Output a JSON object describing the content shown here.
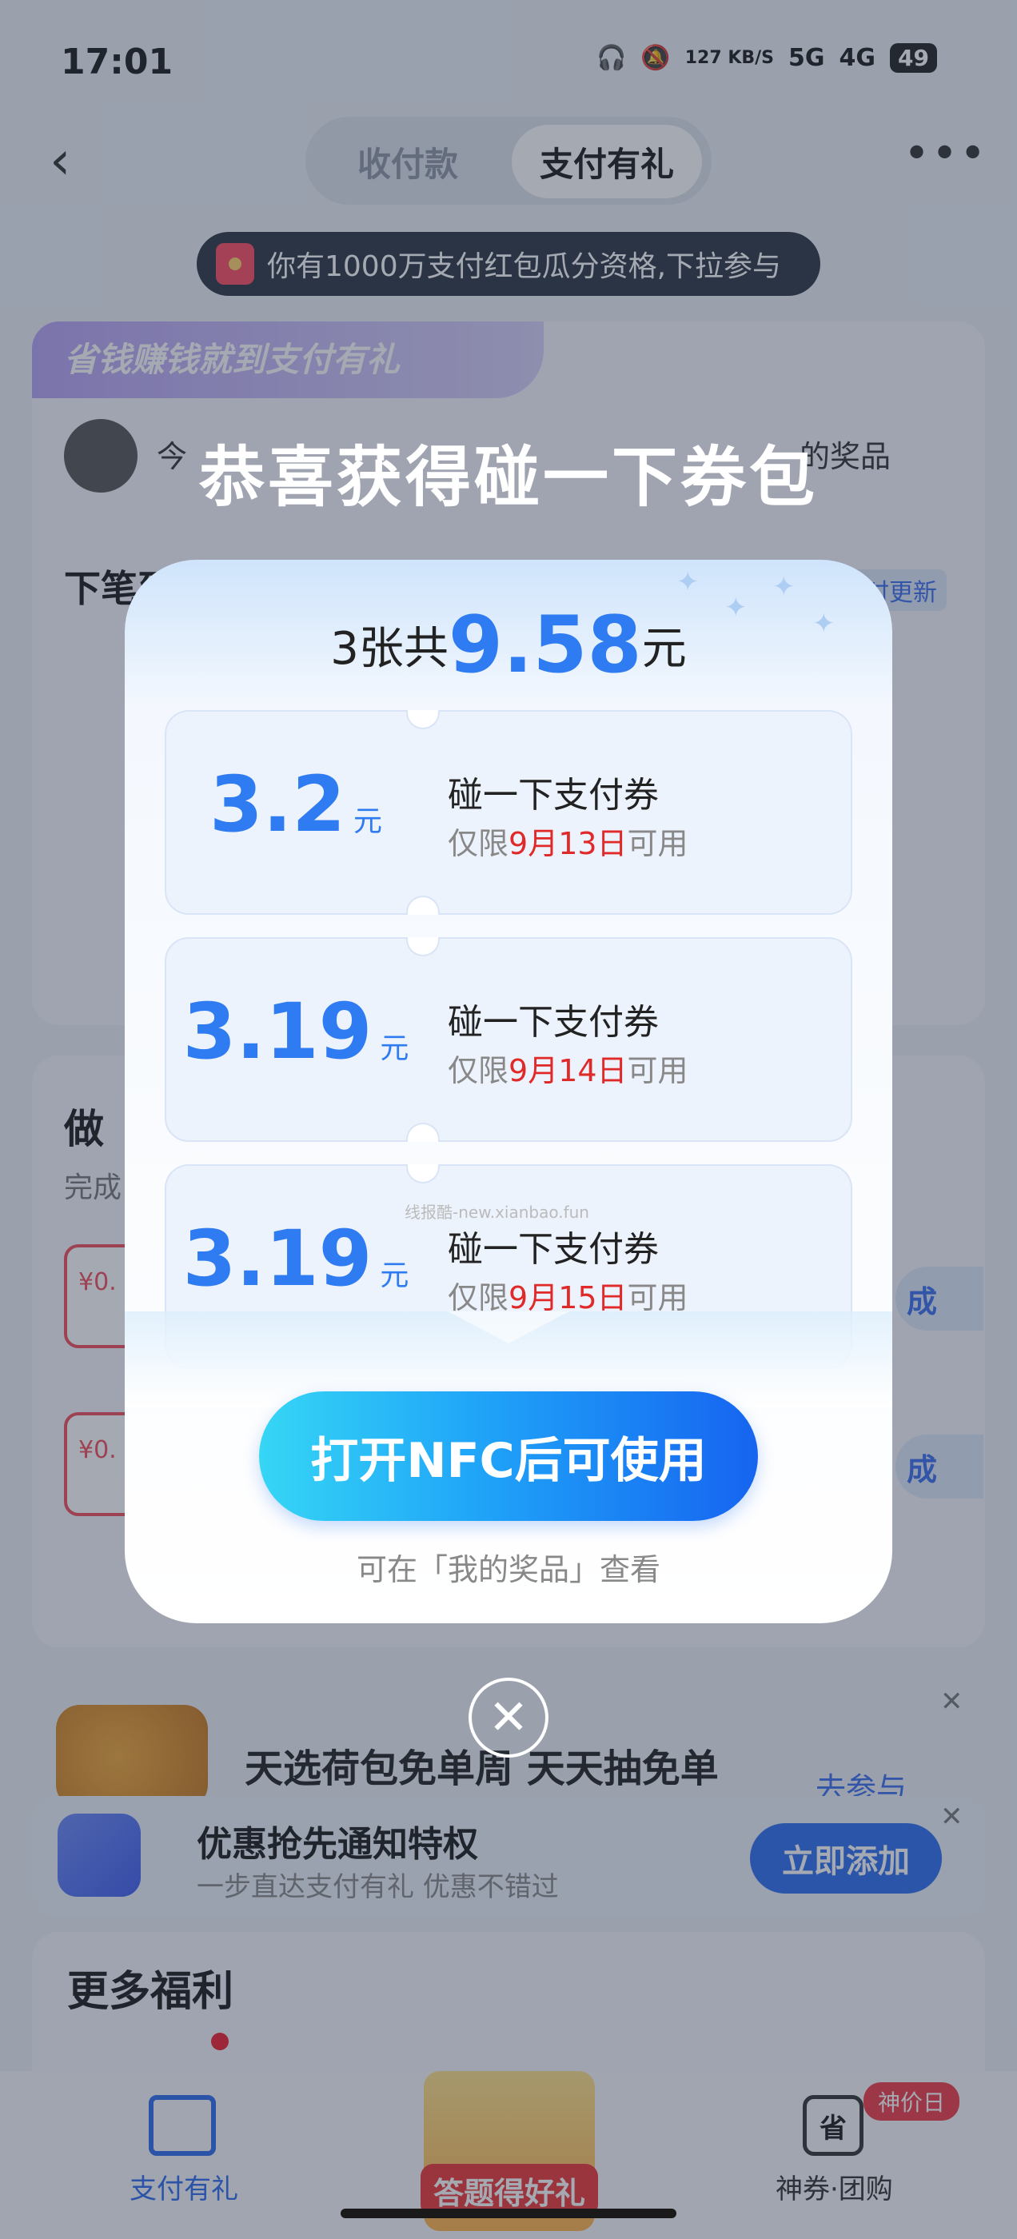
{
  "status_bar": {
    "time": "17:01",
    "net_speed": "127 KB/S",
    "signal1": "5G",
    "signal2": "4G",
    "battery": "49"
  },
  "header": {
    "tabs": [
      "收付款",
      "支付有礼"
    ],
    "active_tab": "支付有礼"
  },
  "notice": {
    "text": "你有1000万支付红包瓜分资格,下拉参与"
  },
  "banner": {
    "slogan": "省钱赚钱就到支付有礼"
  },
  "user_row": {
    "text": "今",
    "prize_link": "的奖品"
  },
  "next_section": {
    "title": "下笔到",
    "tag": "实时更新"
  },
  "task_section": {
    "title": "做",
    "subtitle": "完成",
    "card1": "¥0.",
    "card2": "¥0.",
    "btn1": "成",
    "btn2": "成"
  },
  "ad1": {
    "text": "天选荷包免单周 天天抽免单",
    "button": "去参与"
  },
  "notify": {
    "title": "优惠抢先通知特权",
    "subtitle": "一步直达支付有礼 优惠不错过",
    "button": "立即添加"
  },
  "more": {
    "title": "更多福利"
  },
  "tabbar": {
    "left_label": "支付有礼",
    "center_label": "答题得好礼",
    "right_label": "神券·团购",
    "right_badge": "神价日",
    "right_icon_text": "省"
  },
  "modal": {
    "title": "恭喜获得碰一下券包",
    "total_prefix": "3张共",
    "total_amount": "9.58",
    "total_suffix": "元",
    "coupons": [
      {
        "amount": "3.2",
        "unit": "元",
        "name": "碰一下支付券",
        "valid_prefix": "仅限",
        "valid_date": "9月13日",
        "valid_suffix": "可用"
      },
      {
        "amount": "3.19",
        "unit": "元",
        "name": "碰一下支付券",
        "valid_prefix": "仅限",
        "valid_date": "9月14日",
        "valid_suffix": "可用"
      },
      {
        "amount": "3.19",
        "unit": "元",
        "name": "碰一下支付券",
        "valid_prefix": "仅限",
        "valid_date": "9月15日",
        "valid_suffix": "可用"
      }
    ],
    "watermark": "线报酷-new.xianbao.fun",
    "button": "打开NFC后可使用",
    "hint": "可在「我的奖品」查看"
  },
  "colors": {
    "accent_blue": "#2f7bf2",
    "date_red": "#e02a2a",
    "button_gradient_start": "#36d6f5",
    "button_gradient_end": "#1664f0"
  }
}
